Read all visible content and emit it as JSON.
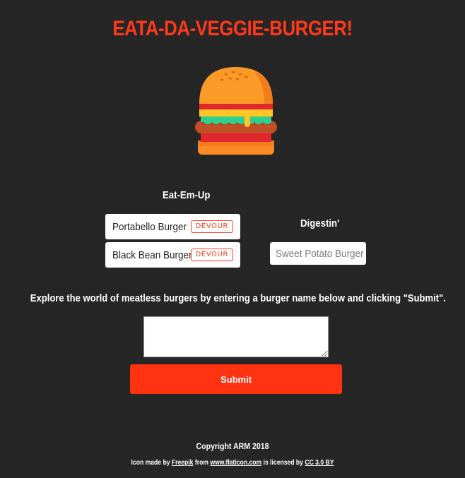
{
  "header": {
    "title": "EATA-DA-VEGGIE-BURGER!",
    "logo_icon": "burger-icon"
  },
  "columns": {
    "eat": {
      "heading": "Eat-Em-Up",
      "burgers": [
        {
          "name": "Portabello Burger",
          "action": "DEVOUR"
        },
        {
          "name": "Black Bean Burger",
          "action": "DEVOUR"
        }
      ]
    },
    "digest": {
      "heading": "Digestin'",
      "burgers": [
        {
          "name": "Sweet Potato Burger"
        }
      ]
    }
  },
  "form": {
    "instructions": "Explore the world of meatless burgers by entering a burger name below and clicking \"Submit\".",
    "input_value": "",
    "submit_label": "Submit"
  },
  "footer": {
    "copyright": "Copyright ARM 2018",
    "credit_prefix": "Icon made by",
    "author_link": "Freepik",
    "from_text": "from",
    "site_link": "www.flaticon.com",
    "licensed_text": "is licensed by",
    "license_link": "CC 3.0 BY"
  },
  "colors": {
    "background": "#262626",
    "accent": "#ff3a1a",
    "submit": "#ff3211"
  }
}
